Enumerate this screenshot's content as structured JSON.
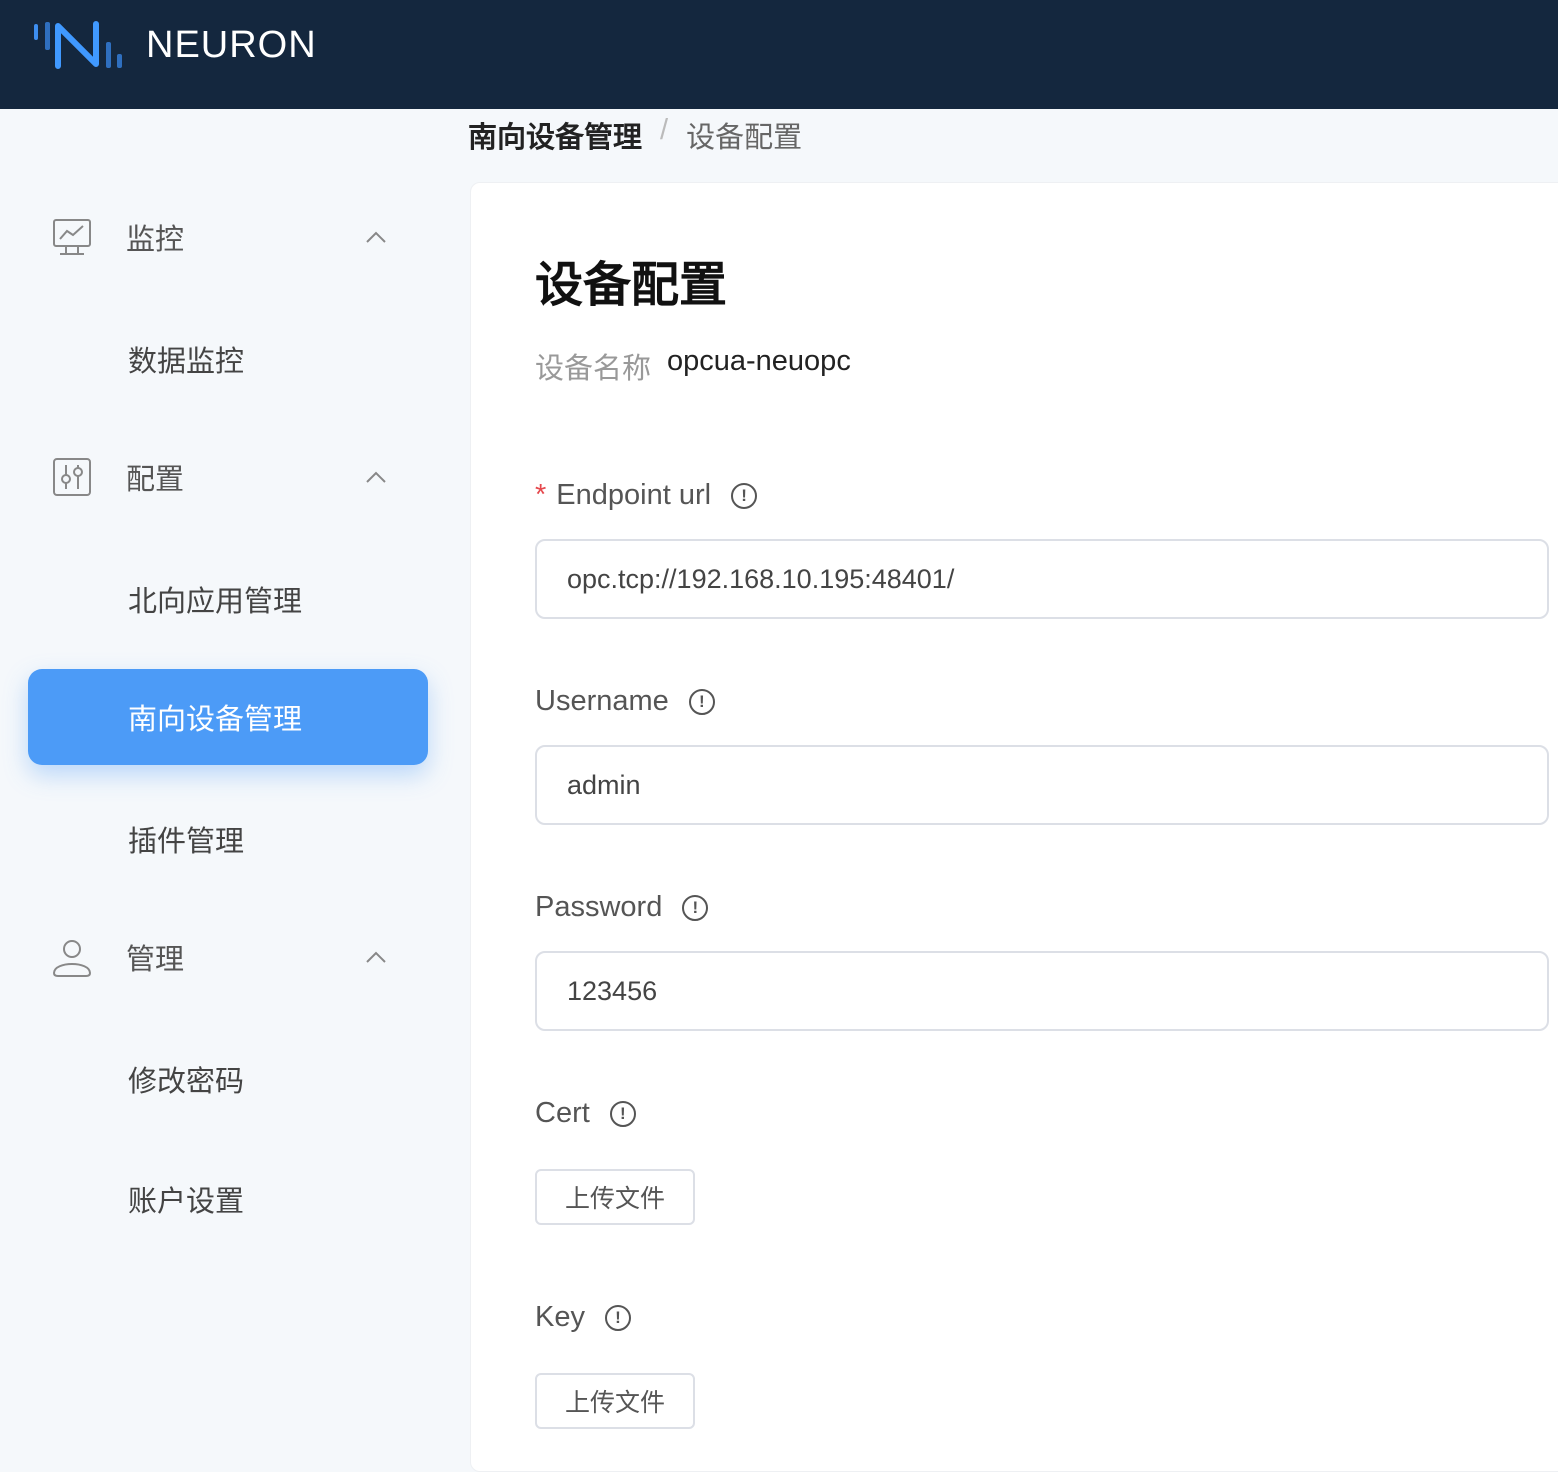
{
  "header": {
    "brand": "NEURON"
  },
  "sidebar": {
    "groups": [
      {
        "label": "监控"
      },
      {
        "label": "配置"
      },
      {
        "label": "管理"
      }
    ],
    "items": [
      {
        "label": "数据监控"
      },
      {
        "label": "北向应用管理"
      },
      {
        "label": "南向设备管理"
      },
      {
        "label": "插件管理"
      },
      {
        "label": "修改密码"
      },
      {
        "label": "账户设置"
      }
    ]
  },
  "breadcrumb": {
    "parent": "南向设备管理",
    "separator": "/",
    "current": "设备配置"
  },
  "main": {
    "title": "设备配置",
    "device_name_label": "设备名称",
    "device_name": "opcua-neuopc",
    "fields": [
      {
        "label": "Endpoint url",
        "required_mark": "*",
        "value": "opc.tcp://192.168.10.195:48401/"
      },
      {
        "label": "Username",
        "value": "admin"
      },
      {
        "label": "Password",
        "value": "123456"
      },
      {
        "label": "Cert",
        "button": "上传文件"
      },
      {
        "label": "Key",
        "button": "上传文件"
      }
    ],
    "info_glyph": "!"
  },
  "colors": {
    "accent": "#4c9bf7",
    "header_bg": "#14273e"
  }
}
